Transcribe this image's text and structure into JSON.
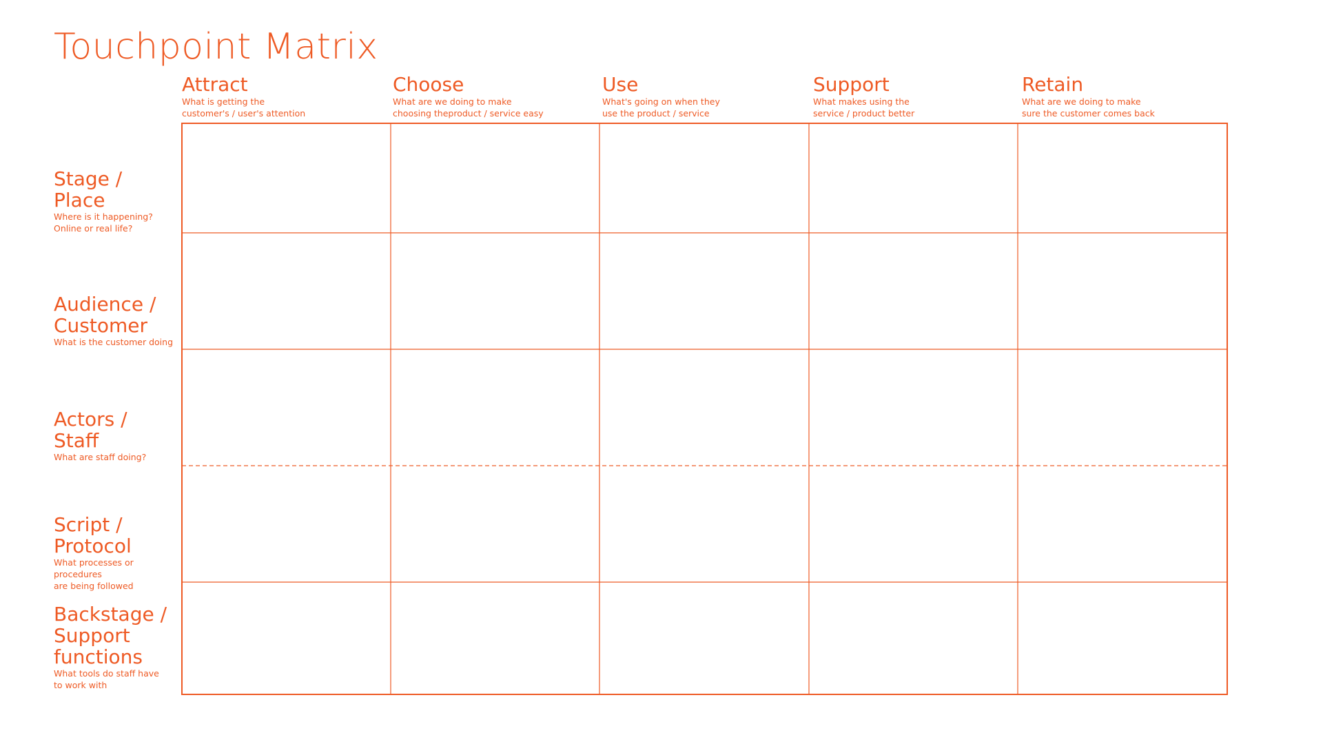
{
  "title": "Touchpoint Matrix",
  "accent_color": "#ee5a24",
  "columns": [
    {
      "label": "Attract",
      "desc": "What is getting the\ncustomer's / user's attention"
    },
    {
      "label": "Choose",
      "desc": "What are we doing to make\nchoosing theproduct / service easy"
    },
    {
      "label": "Use",
      "desc": "What's going on when they\nuse the product / service"
    },
    {
      "label": "Support",
      "desc": "What makes using the\nservice / product better"
    },
    {
      "label": "Retain",
      "desc": "What are we doing to make\nsure the customer comes back"
    }
  ],
  "rows": [
    {
      "label": "Stage /\nPlace",
      "desc": "Where is it happening?\nOnline or real life?"
    },
    {
      "label": "Audience /\nCustomer",
      "desc": "What is the customer doing"
    },
    {
      "label": "Actors /\nStaff",
      "desc": "What are staff doing?"
    },
    {
      "label": "Script /\nProtocol",
      "desc": "What processes or procedures\nare being followed"
    },
    {
      "label": "Backstage /\nSupport\nfunctions",
      "desc": "What tools do staff have\nto work with"
    }
  ]
}
